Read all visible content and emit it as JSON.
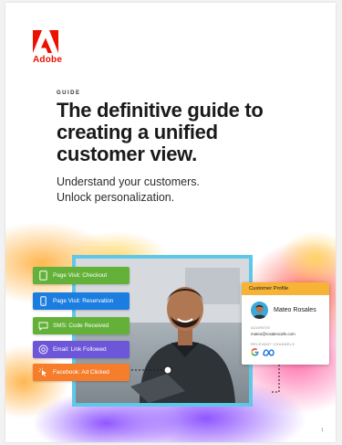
{
  "brand": {
    "name": "Adobe",
    "color": "#eb1000"
  },
  "eyebrow": "GUIDE",
  "title": "The definitive guide to creating a unified customer view.",
  "subtitle_line1": "Understand your customers.",
  "subtitle_line2": "Unlock personalization.",
  "events": [
    {
      "label": "Page Visit: Checkout",
      "color": "#63b138",
      "icon": "tablet-icon"
    },
    {
      "label": "Page Visit: Reservation",
      "color": "#1c7de0",
      "icon": "phone-icon"
    },
    {
      "label": "SMS: Code Received",
      "color": "#63b138",
      "icon": "chat-icon"
    },
    {
      "label": "Email: Link Followed",
      "color": "#6e56d8",
      "icon": "at-icon"
    },
    {
      "label": "Facebook: Ad Clicked",
      "color": "#f57d2c",
      "icon": "click-icon"
    }
  ],
  "profile": {
    "header": "Customer Profile",
    "name": "Mateo Rosales",
    "address_label": "ADDRESS",
    "email": "mateo@rosalescafe.com",
    "channels_label": "RELEVANT CHANNELS",
    "channels": [
      "google-icon",
      "meta-icon"
    ]
  },
  "page_number": "1"
}
